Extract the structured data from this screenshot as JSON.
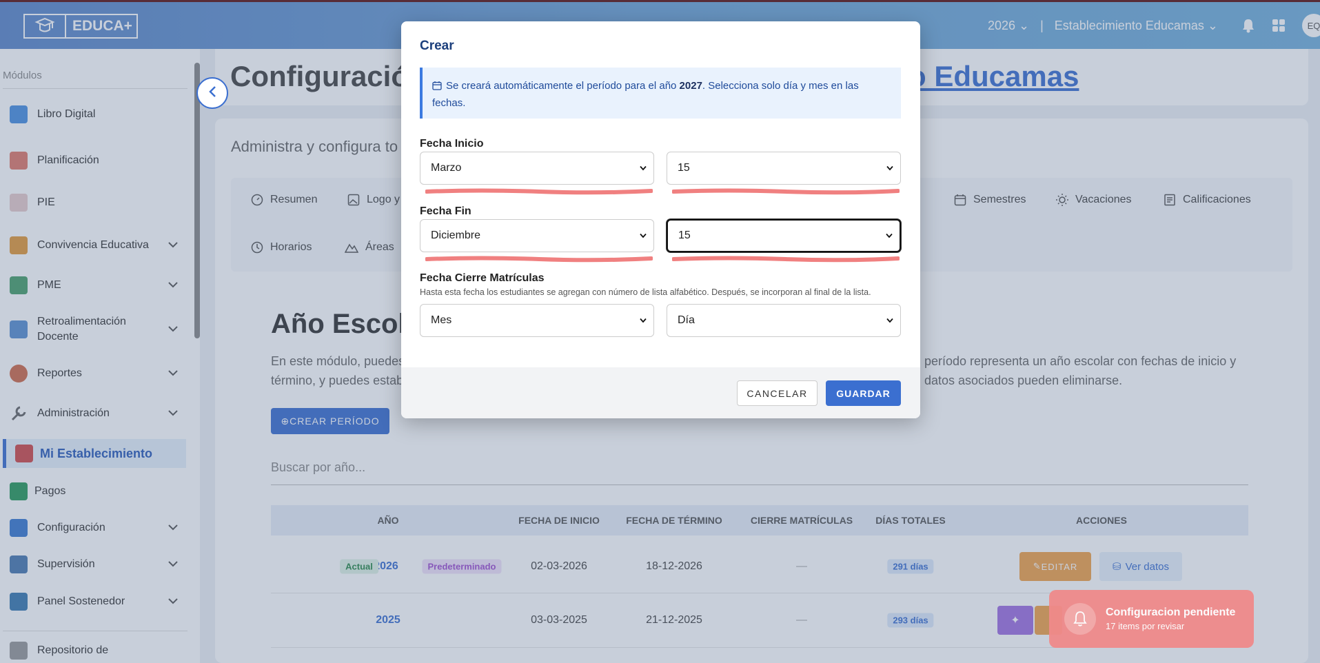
{
  "header": {
    "logo_text": "EDUCA+",
    "year": "2026",
    "separator": "|",
    "establishment": "Establecimiento Educamas",
    "avatar_initials": "EQ"
  },
  "sidebar": {
    "title": "Módulos",
    "items": [
      {
        "label": "Libro Digital",
        "icon": "book-icon",
        "color": "#4a8fe0"
      },
      {
        "label": "Planificación",
        "icon": "calendar-icon",
        "color": "#e07a6a"
      },
      {
        "label": "PIE",
        "icon": "puzzle-icon",
        "color": "#e0c0c0"
      },
      {
        "label": "Convivencia Educativa",
        "icon": "people-icon",
        "color": "#e39a3a"
      },
      {
        "label": "PME",
        "icon": "chart-icon",
        "color": "#4aa06a"
      },
      {
        "label": "Retroalimentación Docente",
        "icon": "feedback-icon",
        "color": "#5a8fd0"
      },
      {
        "label": "Reportes",
        "icon": "pie-icon",
        "color": "#d06a4a"
      },
      {
        "label": "Administración",
        "icon": "wrench-icon",
        "color": "#666"
      },
      {
        "label": "Mi Establecimiento",
        "icon": "school-icon",
        "color": "#d04a4a"
      },
      {
        "label": "Pagos",
        "icon": "money-icon",
        "color": "#2a9a5a"
      },
      {
        "label": "Configuración",
        "icon": "tools-icon",
        "color": "#3a7ad0"
      },
      {
        "label": "Supervisión",
        "icon": "supervision-icon",
        "color": "#4a7ab0"
      },
      {
        "label": "Panel Sostenedor",
        "icon": "panel-icon",
        "color": "#3a7ab0"
      },
      {
        "label": "Repositorio de",
        "icon": "repo-icon",
        "color": "#888"
      }
    ]
  },
  "page": {
    "title_left": "Configuració",
    "title_right": "o Educamas",
    "subtitle": "Administra y configura to",
    "tabs": [
      {
        "label": "Resumen"
      },
      {
        "label": "Logo y"
      },
      {
        "label": "Semestres"
      },
      {
        "label": "Vacaciones"
      },
      {
        "label": "Calificaciones"
      },
      {
        "label": "Horarios"
      },
      {
        "label": "Áreas"
      }
    ],
    "section_title": "Año Escol",
    "desc_left_1": "En este módulo, puedes",
    "desc_left_2": "término, y puedes estab",
    "desc_right_1": "período representa un año escolar con fechas de inicio y",
    "desc_right_2": "datos asociados pueden eliminarse.",
    "create_button": "⊕CREAR PERÍODO",
    "search_placeholder": "Buscar por año...",
    "table": {
      "headers": [
        "AÑO",
        "FECHA DE INICIO",
        "FECHA DE TÉRMINO",
        "CIERRE MATRÍCULAS",
        "DÍAS TOTALES",
        "ACCIONES"
      ],
      "rows": [
        {
          "year": "2026",
          "badge_actual": "Actual",
          "badge_default": "Predeterminado",
          "start": "02-03-2026",
          "end": "18-12-2026",
          "close": "—",
          "days": "291 días",
          "edit": "EDITAR",
          "view": "Ver datos"
        },
        {
          "year": "2025",
          "start": "03-03-2025",
          "end": "21-12-2025",
          "close": "—",
          "days": "293 días"
        }
      ]
    }
  },
  "modal": {
    "title": "Crear",
    "info_pre": "Se creará automáticamente el período para el año ",
    "info_year": "2027",
    "info_post": ". Selecciona solo día y mes en las",
    "info_line2": "fechas.",
    "start_label": "Fecha Inicio",
    "start_month": "Marzo",
    "start_day": "15",
    "end_label": "Fecha Fin",
    "end_month": "Diciembre",
    "end_day": "15",
    "close_label": "Fecha Cierre Matrículas",
    "close_help": "Hasta esta fecha los estudiantes se agregan con número de lista alfabético. Después, se incorporan al final de la lista.",
    "close_month": "Mes",
    "close_day": "Día",
    "cancel": "CANCELAR",
    "save": "GUARDAR"
  },
  "toast": {
    "title": "Configuracion pendiente",
    "subtitle": "17 items por revisar"
  },
  "colors": {
    "primary": "#3b6fd0",
    "header": "#6ea3d4",
    "underline": "#f08080"
  }
}
